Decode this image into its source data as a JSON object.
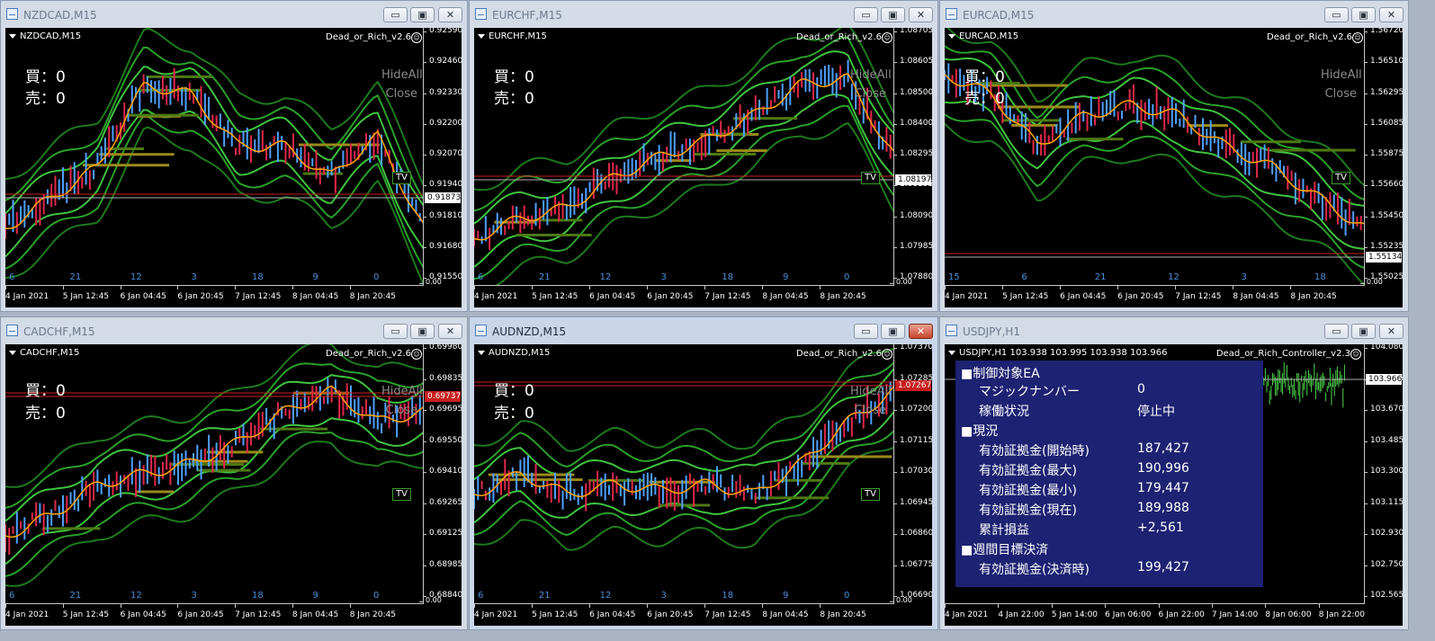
{
  "windows": [
    {
      "title": "NZDCAD,M15",
      "symbol": "NZDCAD,M15",
      "ea": "Dead_or_Rich_v2.6",
      "buy": "買：0",
      "sell": "売：0",
      "hideall": "HideAll",
      "close": "Close",
      "tv": "TV",
      "price_ticks": [
        "0.92590",
        "0.92460",
        "0.92330",
        "0.92200",
        "0.92070",
        "0.91940",
        "0.91810",
        "0.91680",
        "0.91550"
      ],
      "current_price": "0.91873",
      "time_ticks": [
        "4 Jan 2021",
        "5 Jan 12:45",
        "6 Jan 04:45",
        "6 Jan 20:45",
        "7 Jan 12:45",
        "8 Jan 04:45",
        "8 Jan 20:45"
      ],
      "day_ticks": [
        "6",
        "21",
        "12",
        "3",
        "18",
        "9",
        "0"
      ],
      "scale_zero": "0.00"
    },
    {
      "title": "EURCHF,M15",
      "symbol": "EURCHF,M15",
      "ea": "Dead_or_Rich_v2.6",
      "buy": "買：0",
      "sell": "売：0",
      "hideall": "HideAll",
      "close": "Close",
      "tv": "TV",
      "price_ticks": [
        "1.08705",
        "1.08605",
        "1.08500",
        "1.08400",
        "1.08295",
        "1.08195",
        "1.08090",
        "1.07985",
        "1.07880"
      ],
      "current_price": "1.08197",
      "time_ticks": [
        "4 Jan 2021",
        "5 Jan 12:45",
        "6 Jan 04:45",
        "6 Jan 20:45",
        "7 Jan 12:45",
        "8 Jan 04:45",
        "8 Jan 20:45"
      ],
      "day_ticks": [
        "6",
        "21",
        "12",
        "3",
        "18",
        "9",
        "0"
      ],
      "scale_zero": "0.00"
    },
    {
      "title": "EURCAD,M15",
      "symbol": "EURCAD,M15",
      "ea": "Dead_or_Rich_v2.6",
      "buy": "買：0",
      "sell": "売：0",
      "hideall": "HideAll",
      "close": "Close",
      "tv": "TV",
      "price_ticks": [
        "1.56720",
        "1.56510",
        "1.56295",
        "1.56085",
        "1.55875",
        "1.55660",
        "1.55450",
        "1.55235",
        "1.55025"
      ],
      "current_price": "1.55134",
      "time_ticks": [
        "4 Jan 2021",
        "5 Jan 12:45",
        "6 Jan 04:45",
        "6 Jan 20:45",
        "7 Jan 12:45",
        "8 Jan 04:45",
        "8 Jan 20:45"
      ],
      "day_ticks": [
        "15",
        "6",
        "21",
        "12",
        "3",
        "18"
      ],
      "scale_zero": "0.00"
    },
    {
      "title": "CADCHF,M15",
      "symbol": "CADCHF,M15",
      "ea": "Dead_or_Rich_v2.6",
      "buy": "買：0",
      "sell": "売：0",
      "hideall": "HideAll",
      "close": "Close",
      "tv": "TV",
      "price_ticks": [
        "0.69980",
        "0.69835",
        "0.69695",
        "0.69550",
        "0.69410",
        "0.69265",
        "0.69125",
        "0.68985",
        "0.68840"
      ],
      "current_price": "0.69737",
      "time_ticks": [
        "4 Jan 2021",
        "5 Jan 12:45",
        "6 Jan 04:45",
        "6 Jan 20:45",
        "7 Jan 12:45",
        "8 Jan 04:45",
        "8 Jan 20:45"
      ],
      "day_ticks": [
        "6",
        "21",
        "12",
        "3",
        "18",
        "9",
        "0"
      ],
      "scale_zero": "0.00"
    },
    {
      "title": "AUDNZD,M15",
      "symbol": "AUDNZD,M15",
      "ea": "Dead_or_Rich_v2.6",
      "buy": "買：0",
      "sell": "売：0",
      "hideall": "HideAll",
      "close": "Close",
      "tv": "TV",
      "price_ticks": [
        "1.07370",
        "1.07285",
        "1.07200",
        "1.07115",
        "1.07030",
        "1.06945",
        "1.06860",
        "1.06775",
        "1.06690"
      ],
      "current_price": "1.07267",
      "time_ticks": [
        "4 Jan 2021",
        "5 Jan 12:45",
        "6 Jan 04:45",
        "6 Jan 20:45",
        "7 Jan 12:45",
        "8 Jan 04:45",
        "8 Jan 20:45"
      ],
      "day_ticks": [
        "6",
        "21",
        "12",
        "3",
        "18",
        "9",
        "0"
      ],
      "scale_zero": "0.00"
    },
    {
      "title": "USDJPY,H1",
      "symbol": "USDJPY,H1",
      "quote": "103.938 103.995 103.938 103.966",
      "ea": "Dead_or_Rich_Controller_v2.3",
      "price_ticks": [
        "104.080",
        "103.855",
        "103.670",
        "103.485",
        "103.300",
        "103.115",
        "102.930",
        "102.750",
        "102.565"
      ],
      "current_price": "103.966",
      "time_ticks": [
        "4 Jan 2021",
        "4 Jan 22:00",
        "5 Jan 14:00",
        "6 Jan 06:00",
        "6 Jan 22:00",
        "7 Jan 14:00",
        "8 Jan 06:00",
        "8 Jan 22:00"
      ],
      "panel": {
        "h1": "■制御対象EA",
        "magic_label": "マジックナンバー",
        "magic_value": "0",
        "status_label": "稼働状況",
        "status_value": "停止中",
        "h2": "■現況",
        "start_label": "有効証拠金(開始時)",
        "start_value": "187,427",
        "max_label": "有効証拠金(最大)",
        "max_value": "190,996",
        "min_label": "有効証拠金(最小)",
        "min_value": "179,447",
        "now_label": "有効証拠金(現在)",
        "now_value": "189,988",
        "pl_label": "累計損益",
        "pl_value": "+2,561",
        "h3": "■週間目標決済",
        "settle_label": "有効証拠金(決済時)",
        "settle_value": "199,427"
      }
    }
  ],
  "buttons": {
    "min": "▭",
    "max": "▣",
    "close": "✕"
  }
}
